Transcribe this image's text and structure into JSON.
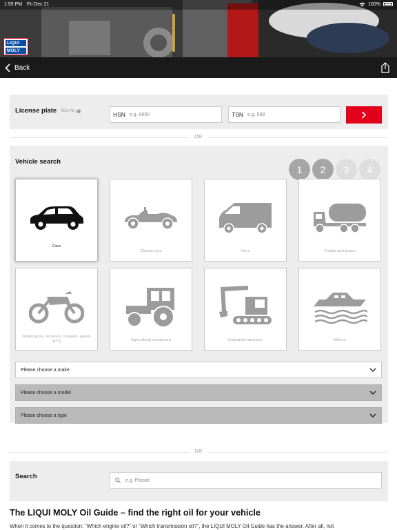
{
  "status_bar": {
    "time": "1:55 PM",
    "date": "Fri Dec 21",
    "battery": "100%"
  },
  "brand": {
    "logo_line1": "LIQUI",
    "logo_line2": "MOLY",
    "accent": "#e3001b",
    "logo_blue": "#0b4ea2"
  },
  "navbar": {
    "back_label": "Back",
    "share_icon": "share-icon"
  },
  "license_plate": {
    "label": "License plate",
    "kba_label": "KBA-Nr.",
    "hsn_prefix": "HSN",
    "hsn_placeholder": "e.g. 0600",
    "tsn_prefix": "TSN",
    "tsn_placeholder": "e.g. 599",
    "submit_icon": "chevron-right-icon"
  },
  "or_label_1": "OR",
  "vehicle_search": {
    "label": "Vehicle search",
    "steps": [
      "1",
      "2",
      "3",
      "4"
    ],
    "categories": [
      {
        "label": "Cars",
        "icon": "car-icon",
        "selected": true
      },
      {
        "label": "Classic cars",
        "icon": "classic-car-icon"
      },
      {
        "label": "Vans",
        "icon": "van-icon"
      },
      {
        "label": "Trucks and buses",
        "icon": "truck-icon"
      },
      {
        "label": "Motorcycles, scooters, mopeds, quads (ATV)",
        "icon": "motorcycle-icon"
      },
      {
        "label": "Agricultural equipment",
        "icon": "tractor-icon"
      },
      {
        "label": "Industrial machines",
        "icon": "excavator-icon"
      },
      {
        "label": "Marine",
        "icon": "boat-icon"
      }
    ],
    "make_select": "Please choose a make",
    "model_select": "Please choose a model",
    "type_select": "Please choose a type"
  },
  "or_label_2": "OR",
  "search": {
    "label": "Search",
    "placeholder": "e.g. Passat"
  },
  "guide": {
    "title": "The LIQUI MOLY Oil Guide – find the right oil for your vehicle",
    "text": "When it comes to the question: “Which engine oil?” or “Which transmission oil?”, the LIQUI MOLY Oil Guide has the answer. After all, not"
  }
}
